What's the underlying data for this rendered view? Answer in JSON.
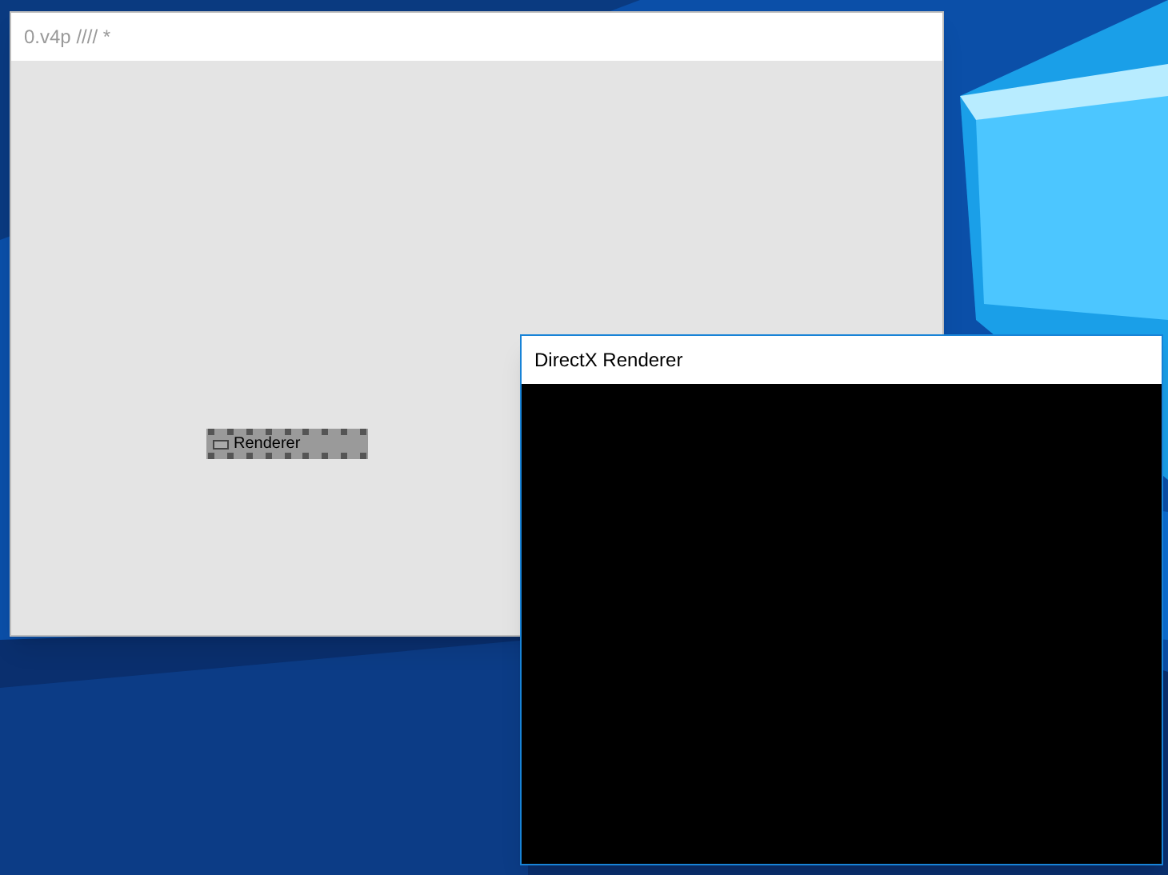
{
  "windows": [
    {
      "title": "0.v4p //// *",
      "active": false,
      "kind": "patch",
      "nodes": [
        {
          "label": "Renderer"
        }
      ]
    },
    {
      "title": "DirectX Renderer",
      "active": true,
      "kind": "renderer"
    }
  ]
}
